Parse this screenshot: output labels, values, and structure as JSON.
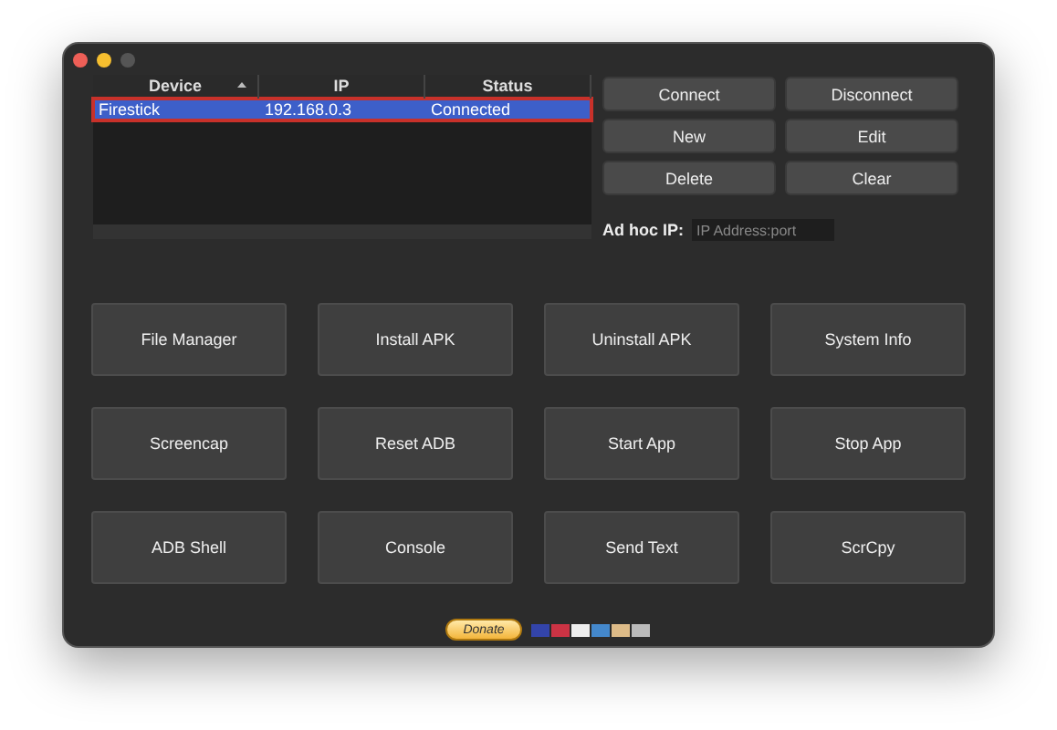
{
  "table": {
    "columns": [
      {
        "label": "Device",
        "sorted": true
      },
      {
        "label": "IP",
        "sorted": false
      },
      {
        "label": "Status",
        "sorted": false
      }
    ],
    "rows": [
      {
        "cells": [
          "Firestick",
          "192.168.0.3",
          "Connected"
        ],
        "selected": true
      }
    ]
  },
  "side_buttons": [
    "Connect",
    "Disconnect",
    "New",
    "Edit",
    "Delete",
    "Clear"
  ],
  "ad_hoc": {
    "label": "Ad hoc IP:",
    "placeholder": "IP Address:port"
  },
  "actions": [
    "File Manager",
    "Install APK",
    "Uninstall APK",
    "System Info",
    "Screencap",
    "Reset ADB",
    "Start App",
    "Stop App",
    "ADB Shell",
    "Console",
    "Send Text",
    "ScrCpy"
  ],
  "donate": {
    "label": "Donate"
  }
}
